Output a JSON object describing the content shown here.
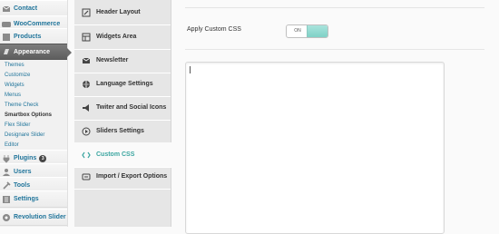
{
  "wp_menu": {
    "top_items": [
      {
        "label": "Contact",
        "icon": "mail-icon"
      },
      {
        "label": "WooCommerce",
        "icon": "woocommerce-icon"
      },
      {
        "label": "Products",
        "icon": "products-icon"
      }
    ],
    "active": {
      "label": "Appearance",
      "icon": "appearance-icon"
    },
    "submenu": [
      "Themes",
      "Customize",
      "Widgets",
      "Menus",
      "Theme Check",
      "Smartbox Options",
      "Flex Slider",
      "Designare Slider",
      "Editor"
    ],
    "submenu_current": "Smartbox Options",
    "bottom_items": [
      {
        "label": "Plugins",
        "icon": "plugins-icon",
        "badge": "3"
      },
      {
        "label": "Users",
        "icon": "users-icon"
      },
      {
        "label": "Tools",
        "icon": "tools-icon"
      },
      {
        "label": "Settings",
        "icon": "settings-icon"
      },
      {
        "label": "Revolution Slider",
        "icon": "revolution-slider-icon"
      }
    ]
  },
  "options_tabs": [
    {
      "label": "Header Layout",
      "icon": "pencil-icon"
    },
    {
      "label": "Widgets Area",
      "icon": "widgets-icon"
    },
    {
      "label": "Newsletter",
      "icon": "envelope-icon"
    },
    {
      "label": "Language Settings",
      "icon": "globe-icon"
    },
    {
      "label": "Twiter and Social Icons",
      "icon": "megaphone-icon"
    },
    {
      "label": "Sliders Settings",
      "icon": "play-icon"
    },
    {
      "label": "Custom CSS",
      "icon": "css-icon",
      "active": true
    },
    {
      "label": "Import / Export Options",
      "icon": "import-export-icon"
    }
  ],
  "content": {
    "field_label": "Apply Custom CSS",
    "toggle_state": "ON",
    "css_value": ""
  },
  "colors": {
    "accent": "#3aa5a0",
    "wp_link": "#21759b",
    "active_menu": "#6c6c6c"
  }
}
